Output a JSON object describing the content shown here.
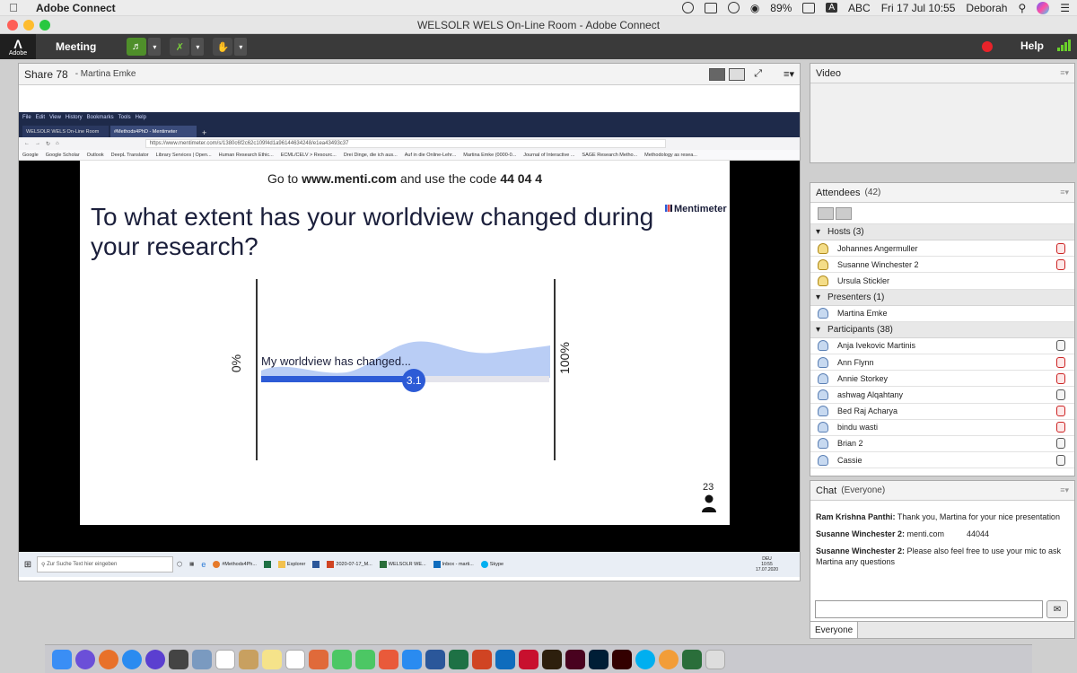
{
  "menubar": {
    "app_name": "Adobe Connect",
    "battery": "89%",
    "input_source": "ABC",
    "input_letter": "A",
    "datetime": "Fri 17 Jul  10:55",
    "user": "Deborah"
  },
  "window": {
    "title": "WELSOLR WELS On-Line Room - Adobe Connect"
  },
  "acbar": {
    "logo_text": "Adobe",
    "meeting_label": "Meeting",
    "help_label": "Help"
  },
  "share_pod": {
    "title": "Share 78",
    "presenter": "- Martina Emke"
  },
  "browser": {
    "menu": [
      "File",
      "Edit",
      "View",
      "History",
      "Bookmarks",
      "Tools",
      "Help"
    ],
    "tabs": [
      "WELSOLR WELS On-Line Room",
      "#Methods4PhD - Mentimeter"
    ],
    "url": "https://www.mentimeter.com/s/1380c6f2c62c109f4d1a96144634248/e1ea43493c37",
    "bookmarks": [
      "Google",
      "Google Scholar",
      "Outlook",
      "DeepL Translator",
      "Library Services | Open...",
      "Human Research Ethic...",
      "ECML/CELV > Resourc...",
      "Drei Dinge, die ich aus...",
      "Auf in die Online-Lehr...",
      "Martina Emke (0000-0...",
      "Journal of Interactive ...",
      "SAGE Research Metho...",
      "Methodology as resea..."
    ]
  },
  "slide": {
    "code_prefix": "Go to ",
    "code_site": "www.menti.com",
    "code_mid": " and use the code ",
    "code_value": "44 04 4",
    "question": "To what extent has your worldview changed during your research?",
    "logo": "Mentimeter",
    "scale_min_label": "0%",
    "scale_max_label": "100%",
    "statement": "My worldview has changed...",
    "average": 3.1,
    "average_label": "3.1",
    "scale_max": 10,
    "votes": "23"
  },
  "taskbar": {
    "search_placeholder": "Zur Suche Text hier eingeben",
    "items": [
      "#Methods4Ph...",
      "Explorer",
      "2020-07-17_M...",
      "WELSOLR WE...",
      "Inbox - marti...",
      "Skype"
    ],
    "lang": "DEU",
    "time": "10:55",
    "date": "17.07.2020"
  },
  "video_pod": {
    "title": "Video"
  },
  "attendees": {
    "title": "Attendees",
    "count": "(42)",
    "groups": [
      {
        "label": "Hosts (3)",
        "role": "host",
        "people": [
          {
            "name": "Johannes Angermuller",
            "mic": "off"
          },
          {
            "name": "Susanne Winchester 2",
            "mic": "off"
          },
          {
            "name": "Ursula Stickler",
            "mic": ""
          }
        ]
      },
      {
        "label": "Presenters (1)",
        "role": "presenter",
        "people": [
          {
            "name": "Martina Emke",
            "mic": ""
          }
        ]
      },
      {
        "label": "Participants (38)",
        "role": "participant",
        "people": [
          {
            "name": "Anja Ivekovic Martinis",
            "mic": "on"
          },
          {
            "name": "Ann Flynn",
            "mic": "off"
          },
          {
            "name": "Annie Storkey",
            "mic": "off"
          },
          {
            "name": "ashwag Alqahtany",
            "mic": "on"
          },
          {
            "name": "Bed Raj Acharya",
            "mic": "off"
          },
          {
            "name": "bindu wasti",
            "mic": "off"
          },
          {
            "name": "Brian 2",
            "mic": "on"
          },
          {
            "name": "Cassie",
            "mic": "on"
          }
        ]
      }
    ]
  },
  "chat": {
    "title": "Chat",
    "scope": "(Everyone)",
    "messages": [
      {
        "author": "Ram Krishna Panthi:",
        "text": " Thank you, Martina for your nice presentation"
      },
      {
        "author": "Susanne Winchester 2:",
        "text": " menti.com          44044"
      },
      {
        "author": "Susanne Winchester 2:",
        "text": " Please also feel free to use your mic to ask Martina any questions"
      }
    ],
    "recipient": "Everyone"
  },
  "colors": {
    "accent": "#2d5bd6",
    "record": "#e8232a",
    "signal": "#6ad12b"
  }
}
